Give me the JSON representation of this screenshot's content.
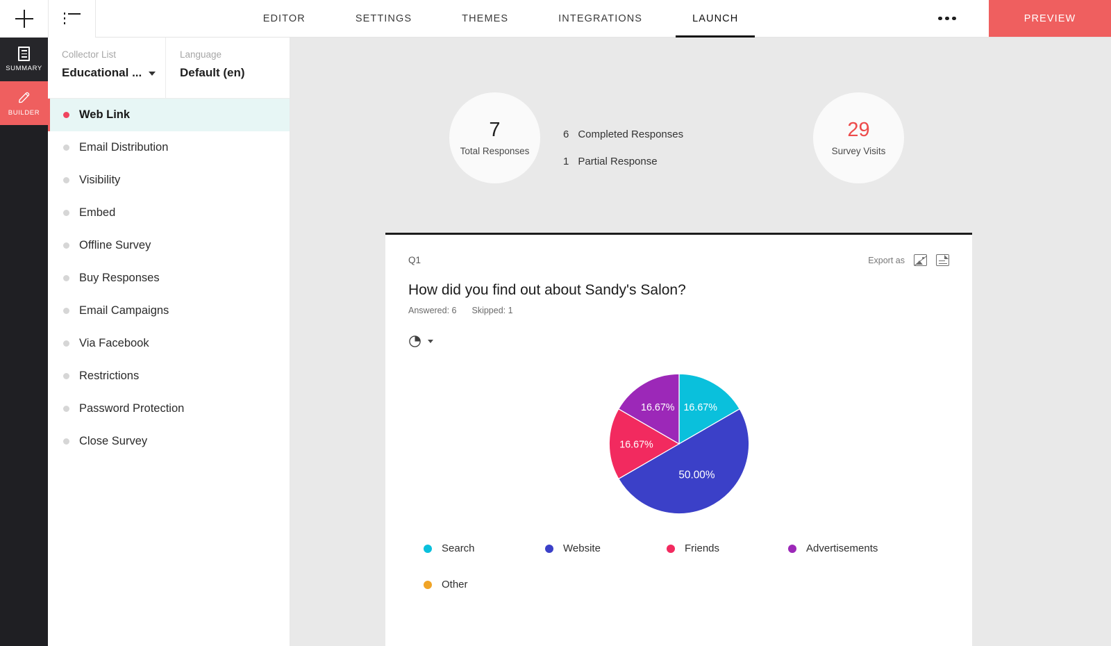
{
  "topbar": {
    "add_icon": "plus-icon",
    "list_icon": "list-icon",
    "tabs": [
      {
        "label": "EDITOR",
        "active": false
      },
      {
        "label": "SETTINGS",
        "active": false
      },
      {
        "label": "THEMES",
        "active": false
      },
      {
        "label": "INTEGRATIONS",
        "active": false
      },
      {
        "label": "LAUNCH",
        "active": true
      }
    ],
    "more_icon": "ellipsis-icon",
    "preview_label": "PREVIEW",
    "preview_color": "#ef5f5f"
  },
  "rail": {
    "items": [
      {
        "label": "SUMMARY",
        "icon": "document-icon",
        "active": false
      },
      {
        "label": "BUILDER",
        "icon": "pencil-icon",
        "active": true
      }
    ]
  },
  "collector": {
    "list_label": "Collector List",
    "list_value": "Educational ...",
    "language_label": "Language",
    "language_value": "Default (en)",
    "items": [
      {
        "label": "Web Link",
        "active": true
      },
      {
        "label": "Email Distribution",
        "active": false
      },
      {
        "label": "Visibility",
        "active": false
      },
      {
        "label": "Embed",
        "active": false
      },
      {
        "label": "Offline Survey",
        "active": false
      },
      {
        "label": "Buy Responses",
        "active": false
      },
      {
        "label": "Email Campaigns",
        "active": false
      },
      {
        "label": "Via Facebook",
        "active": false
      },
      {
        "label": "Restrictions",
        "active": false
      },
      {
        "label": "Password Protection",
        "active": false
      },
      {
        "label": "Close Survey",
        "active": false
      }
    ]
  },
  "stats": {
    "total_responses_value": "7",
    "total_responses_label": "Total Responses",
    "completed_count": "6",
    "completed_label": "Completed Responses",
    "partial_count": "1",
    "partial_label": "Partial Response",
    "survey_visits_value": "29",
    "survey_visits_label": "Survey Visits",
    "survey_visits_color": "#ed4b4b"
  },
  "question_card": {
    "q_number": "Q1",
    "export_label": "Export as",
    "export_image_icon": "image-export-icon",
    "export_pdf_icon": "pdf-export-icon",
    "title": "How did you find out about Sandy's Salon?",
    "answered_label": "Answered: 6",
    "skipped_label": "Skipped: 1",
    "chart_type_icon": "pie-chart-icon",
    "chart_type_caret": "chevron-down-icon"
  },
  "chart_data": {
    "type": "pie",
    "title": "How did you find out about Sandy's Salon?",
    "categories": [
      "Search",
      "Website",
      "Friends",
      "Advertisements",
      "Other"
    ],
    "values": [
      16.67,
      50.0,
      16.67,
      16.67,
      0
    ],
    "labels": [
      "16.67%",
      "50.00%",
      "16.67%",
      "16.67%",
      ""
    ],
    "colors": [
      "#0ac0dc",
      "#3b40c8",
      "#f22a5f",
      "#9c28b8",
      "#f0a427"
    ],
    "legend_position": "bottom",
    "start_angle_deg": 0,
    "slices": [
      {
        "name": "Search",
        "value": 16.67,
        "label": "16.67%",
        "color": "#0ac0dc",
        "start": 0,
        "end": 60
      },
      {
        "name": "Website",
        "value": 50.0,
        "label": "50.00%",
        "color": "#3b40c8",
        "start": 60,
        "end": 240
      },
      {
        "name": "Friends",
        "value": 16.67,
        "label": "16.67%",
        "color": "#f22a5f",
        "start": 240,
        "end": 300
      },
      {
        "name": "Advertisements",
        "value": 16.67,
        "label": "16.67%",
        "color": "#9c28b8",
        "start": 300,
        "end": 360
      },
      {
        "name": "Other",
        "value": 0,
        "label": "",
        "color": "#f0a427",
        "start": 360,
        "end": 360
      }
    ]
  }
}
